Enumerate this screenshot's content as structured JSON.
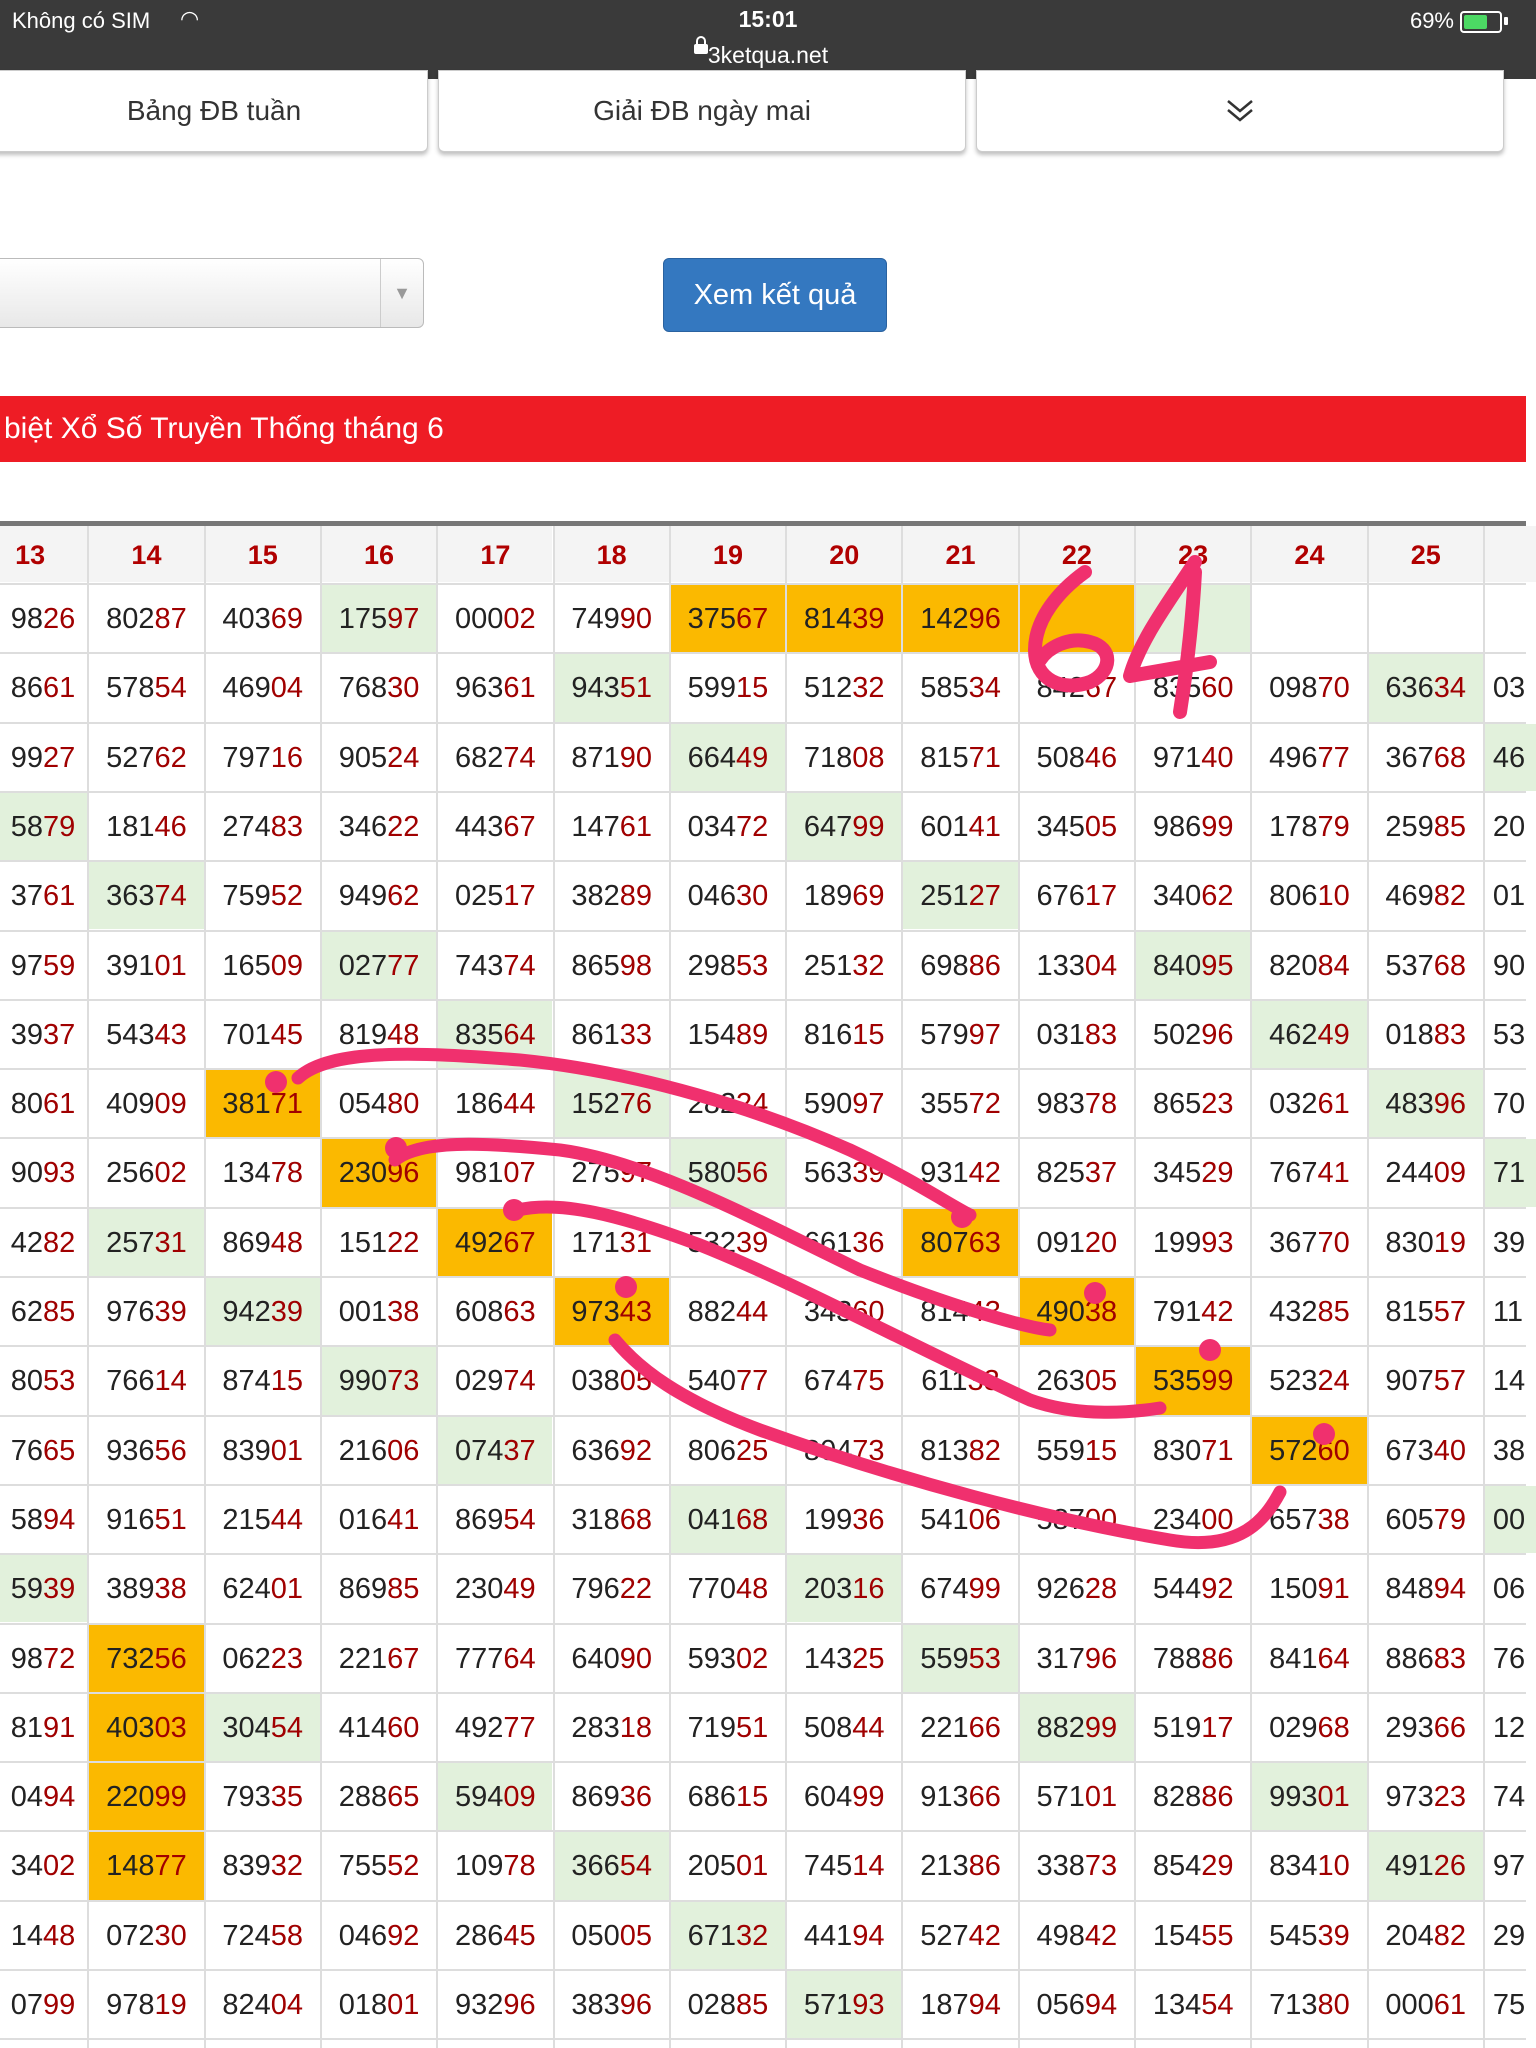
{
  "status_bar": {
    "carrier": "Không có SIM",
    "time": "15:01",
    "url": "3ketqua.net",
    "battery_percent": "69%",
    "battery_level": 0.69
  },
  "tabs": [
    {
      "label": "Bảng ĐB tuần"
    },
    {
      "label": "Giải ĐB ngày mai"
    },
    {
      "label": ""
    }
  ],
  "form": {
    "select_value": "",
    "submit_label": "Xem kết quả"
  },
  "banner_title": "biệt Xổ Số Truyền Thống tháng 6",
  "annotation_text": "64",
  "colors": {
    "highlight_orange": "#fbb900",
    "highlight_green": "#e2f1dc",
    "banner_red": "#ee1c25",
    "ink_pink": "#f0306e",
    "digit_red": "#a00000"
  },
  "table": {
    "headers": [
      "13",
      "14",
      "15",
      "16",
      "17",
      "18",
      "19",
      "20",
      "21",
      "22",
      "23",
      "24",
      "25",
      ""
    ],
    "rows": [
      [
        "9826",
        "80287",
        "40369",
        "17597",
        "00002",
        "74990",
        "37567",
        "81439",
        "14296",
        "",
        "",
        "",
        ""
      ],
      [
        "8661",
        "57854",
        "46904",
        "76830",
        "96361",
        "94351",
        "59915",
        "51232",
        "58534",
        "84267",
        "83560",
        "09870",
        "63634",
        "03"
      ],
      [
        "9927",
        "52762",
        "79716",
        "90524",
        "68274",
        "87190",
        "66449",
        "71808",
        "81571",
        "50846",
        "97140",
        "49677",
        "36768",
        "46"
      ],
      [
        "5879",
        "18146",
        "27483",
        "34622",
        "44367",
        "14761",
        "03472",
        "64799",
        "60141",
        "34505",
        "98699",
        "17879",
        "25985",
        "20"
      ],
      [
        "3761",
        "36374",
        "75952",
        "94962",
        "02517",
        "38289",
        "04630",
        "18969",
        "25127",
        "67617",
        "34062",
        "80610",
        "46982",
        "01"
      ],
      [
        "9759",
        "39101",
        "16509",
        "02777",
        "74374",
        "86598",
        "29853",
        "25132",
        "69886",
        "13304",
        "84095",
        "82084",
        "53768",
        "90"
      ],
      [
        "3937",
        "54343",
        "70145",
        "81948",
        "83564",
        "86133",
        "15489",
        "81615",
        "57997",
        "03183",
        "50296",
        "46249",
        "01883",
        "53"
      ],
      [
        "8061",
        "40909",
        "38171",
        "05480",
        "18644",
        "15276",
        "28224",
        "59097",
        "35572",
        "98378",
        "86523",
        "03261",
        "48396",
        "70"
      ],
      [
        "9093",
        "25602",
        "13478",
        "23096",
        "98107",
        "27597",
        "58056",
        "56339",
        "93142",
        "82537",
        "34529",
        "76741",
        "24409",
        "71"
      ],
      [
        "4282",
        "25731",
        "86948",
        "15122",
        "49267",
        "17131",
        "53239",
        "66136",
        "80763",
        "09120",
        "19993",
        "36770",
        "83019",
        "39"
      ],
      [
        "6285",
        "97639",
        "94239",
        "00138",
        "60863",
        "97343",
        "88244",
        "34360",
        "81443",
        "49038",
        "79142",
        "43285",
        "81557",
        "11"
      ],
      [
        "8053",
        "76614",
        "87415",
        "99073",
        "02974",
        "03805",
        "54077",
        "67475",
        "61133",
        "26305",
        "53599",
        "52324",
        "90757",
        "14"
      ],
      [
        "7665",
        "93656",
        "83901",
        "21606",
        "07437",
        "63692",
        "80625",
        "80473",
        "81382",
        "55915",
        "83071",
        "57260",
        "67340",
        "38"
      ],
      [
        "5894",
        "91651",
        "21544",
        "01641",
        "86954",
        "31868",
        "04168",
        "19936",
        "54106",
        "58700",
        "23400",
        "65738",
        "60579",
        "00"
      ],
      [
        "5939",
        "38938",
        "62401",
        "86985",
        "23049",
        "79622",
        "77048",
        "20316",
        "67499",
        "92628",
        "54492",
        "15091",
        "84894",
        "06"
      ],
      [
        "9872",
        "73256",
        "06223",
        "22167",
        "77764",
        "64090",
        "59302",
        "14325",
        "55953",
        "31796",
        "78886",
        "84164",
        "88683",
        "76"
      ],
      [
        "8191",
        "40303",
        "30454",
        "41460",
        "49277",
        "28318",
        "71951",
        "50844",
        "22166",
        "88299",
        "51917",
        "02968",
        "29366",
        "12"
      ],
      [
        "0494",
        "22099",
        "79335",
        "28865",
        "59409",
        "86936",
        "68615",
        "60499",
        "91366",
        "57101",
        "82886",
        "99301",
        "97323",
        "74"
      ],
      [
        "3402",
        "14877",
        "83932",
        "75552",
        "10978",
        "36654",
        "20501",
        "74514",
        "21386",
        "33873",
        "85429",
        "83410",
        "49126",
        "97"
      ],
      [
        "1448",
        "07230",
        "72458",
        "04692",
        "28645",
        "05005",
        "67132",
        "44194",
        "52742",
        "49842",
        "15455",
        "54539",
        "20482",
        "29"
      ],
      [
        "0799",
        "97819",
        "82404",
        "01801",
        "93296",
        "38396",
        "02885",
        "57193",
        "18794",
        "05694",
        "13454",
        "71380",
        "00061",
        "75"
      ]
    ],
    "highlights": [
      {
        "row": 0,
        "col": 6,
        "kind": "orange"
      },
      {
        "row": 0,
        "col": 7,
        "kind": "orange"
      },
      {
        "row": 0,
        "col": 8,
        "kind": "orange"
      },
      {
        "row": 0,
        "col": 9,
        "kind": "orange"
      },
      {
        "row": 0,
        "col": 3,
        "kind": "green"
      },
      {
        "row": 0,
        "col": 10,
        "kind": "green"
      },
      {
        "row": 1,
        "col": 5,
        "kind": "green"
      },
      {
        "row": 1,
        "col": 12,
        "kind": "green"
      },
      {
        "row": 2,
        "col": 6,
        "kind": "green"
      },
      {
        "row": 2,
        "col": 13,
        "kind": "green"
      },
      {
        "row": 3,
        "col": 0,
        "kind": "green"
      },
      {
        "row": 3,
        "col": 7,
        "kind": "green"
      },
      {
        "row": 4,
        "col": 1,
        "kind": "green"
      },
      {
        "row": 4,
        "col": 8,
        "kind": "green"
      },
      {
        "row": 5,
        "col": 3,
        "kind": "green"
      },
      {
        "row": 5,
        "col": 10,
        "kind": "green"
      },
      {
        "row": 6,
        "col": 4,
        "kind": "green"
      },
      {
        "row": 6,
        "col": 11,
        "kind": "green"
      },
      {
        "row": 7,
        "col": 2,
        "kind": "orange"
      },
      {
        "row": 7,
        "col": 5,
        "kind": "green"
      },
      {
        "row": 7,
        "col": 12,
        "kind": "green"
      },
      {
        "row": 8,
        "col": 3,
        "kind": "orange"
      },
      {
        "row": 8,
        "col": 6,
        "kind": "green"
      },
      {
        "row": 8,
        "col": 13,
        "kind": "green"
      },
      {
        "row": 9,
        "col": 1,
        "kind": "green"
      },
      {
        "row": 9,
        "col": 4,
        "kind": "orange"
      },
      {
        "row": 9,
        "col": 8,
        "kind": "orange"
      },
      {
        "row": 10,
        "col": 2,
        "kind": "green"
      },
      {
        "row": 10,
        "col": 5,
        "kind": "orange"
      },
      {
        "row": 10,
        "col": 9,
        "kind": "orange"
      },
      {
        "row": 11,
        "col": 3,
        "kind": "green"
      },
      {
        "row": 11,
        "col": 10,
        "kind": "orange"
      },
      {
        "row": 12,
        "col": 4,
        "kind": "green"
      },
      {
        "row": 12,
        "col": 11,
        "kind": "orange"
      },
      {
        "row": 13,
        "col": 6,
        "kind": "green"
      },
      {
        "row": 13,
        "col": 13,
        "kind": "green"
      },
      {
        "row": 14,
        "col": 0,
        "kind": "green"
      },
      {
        "row": 14,
        "col": 7,
        "kind": "green"
      },
      {
        "row": 15,
        "col": 1,
        "kind": "orange"
      },
      {
        "row": 15,
        "col": 8,
        "kind": "green"
      },
      {
        "row": 16,
        "col": 1,
        "kind": "orange"
      },
      {
        "row": 16,
        "col": 2,
        "kind": "green"
      },
      {
        "row": 16,
        "col": 9,
        "kind": "green"
      },
      {
        "row": 17,
        "col": 1,
        "kind": "orange"
      },
      {
        "row": 17,
        "col": 4,
        "kind": "green"
      },
      {
        "row": 17,
        "col": 11,
        "kind": "green"
      },
      {
        "row": 18,
        "col": 1,
        "kind": "orange"
      },
      {
        "row": 18,
        "col": 5,
        "kind": "green"
      },
      {
        "row": 18,
        "col": 12,
        "kind": "green"
      },
      {
        "row": 19,
        "col": 6,
        "kind": "green"
      },
      {
        "row": 20,
        "col": 7,
        "kind": "green"
      }
    ]
  }
}
